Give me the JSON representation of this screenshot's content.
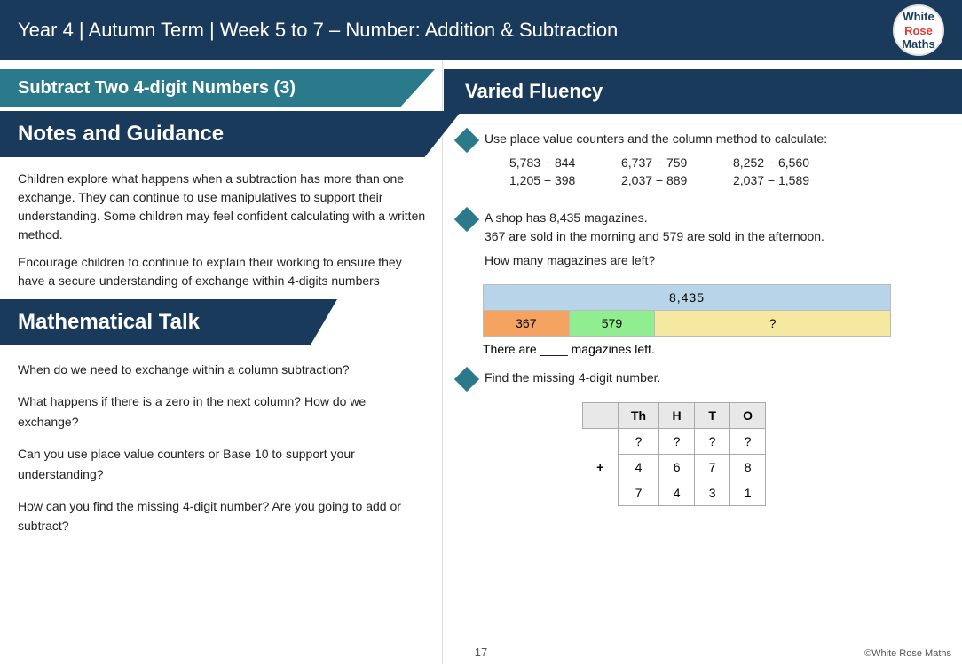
{
  "header": {
    "title": "Year 4 |  Autumn Term  | Week 5 to 7 – Number: Addition & Subtraction",
    "logo": {
      "white": "White",
      "rose": "Rose",
      "maths": "Maths"
    }
  },
  "section_title": "Subtract Two 4-digit Numbers (3)",
  "notes": {
    "heading": "Notes and Guidance",
    "paragraph1": "Children explore what happens when a subtraction has more than one exchange. They can continue to use manipulatives to support their understanding. Some children may feel confident calculating with a written method.",
    "paragraph2": "Encourage children to continue to explain their working to ensure they have a secure understanding of exchange within 4-digits numbers"
  },
  "math_talk": {
    "heading": "Mathematical Talk",
    "questions": [
      "When do we need to exchange within a column subtraction?",
      "What happens if there is a zero in the next column? How do we exchange?",
      "Can you use place value counters or Base 10 to support your understanding?",
      "How can you find the missing 4-digit number? Are you going to add or subtract?"
    ]
  },
  "fluency": {
    "heading": "Varied Fluency",
    "item1": {
      "instruction": "Use place value counters and the column method to calculate:",
      "equations": [
        "5,783 − 844",
        "6,737 − 759",
        "8,252 − 6,560",
        "1,205 − 398",
        "2,037 − 889",
        "2,037 − 1,589"
      ]
    },
    "item2": {
      "intro": "A shop has 8,435 magazines.",
      "detail": "367 are sold in the morning and 579 are sold in the afternoon.",
      "question": "How many magazines are left?",
      "table": {
        "total": "8,435",
        "cell1": "367",
        "cell2": "579",
        "cell3": "?"
      },
      "answer_text": "There are ____ magazines left."
    },
    "item3": {
      "instruction": "Find the missing 4-digit number.",
      "table": {
        "headers": [
          "",
          "Th",
          "H",
          "T",
          "O"
        ],
        "rows": [
          [
            "",
            "?",
            "?",
            "?",
            "?"
          ],
          [
            "+",
            "4",
            "6",
            "7",
            "8"
          ],
          [
            "",
            "7",
            "4",
            "3",
            "1"
          ]
        ]
      }
    }
  },
  "page_number": "17",
  "copyright": "©White Rose Maths"
}
